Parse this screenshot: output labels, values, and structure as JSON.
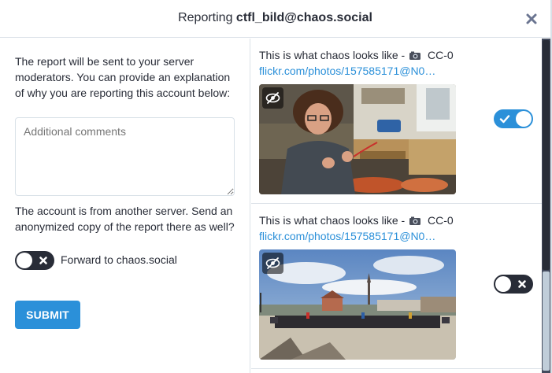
{
  "header": {
    "prefix": "Reporting",
    "account": "ctfl_bild@chaos.social"
  },
  "left": {
    "intro": "The report will be sent to your server moderators. You can provide an explanation of why you are reporting this account below:",
    "comment": {
      "placeholder": "Additional comments",
      "value": ""
    },
    "remote_note": "The account is from another server. Send an anonymized copy of the report there as well?",
    "forward": {
      "label": "Forward to chaos.social",
      "checked": false
    },
    "submit_label": "SUBMIT"
  },
  "statuses": [
    {
      "text": "This is what chaos looks like -",
      "license": "CC-0",
      "link": "flickr.com/photos/157585171@N0…",
      "media_icon": "eye-slash-icon",
      "selected": true
    },
    {
      "text": "This is what chaos looks like -",
      "license": "CC-0",
      "link": "flickr.com/photos/157585171@N0…",
      "media_icon": "eye-slash-icon",
      "selected": false
    }
  ],
  "colors": {
    "accent": "#2b90d9",
    "text": "#282c37",
    "toggle_off": "#282c37",
    "scrollbar": "#444b5d"
  }
}
